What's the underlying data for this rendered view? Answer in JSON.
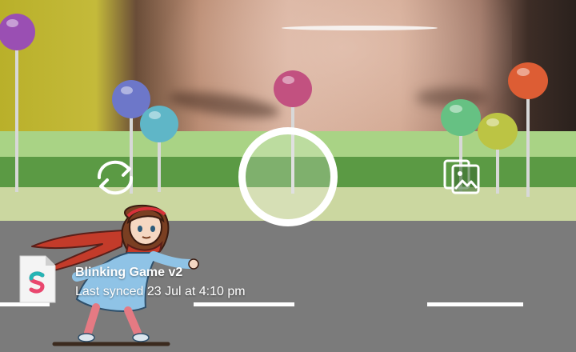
{
  "project": {
    "title": "Blinking Game v2",
    "last_synced": "Last synced 23 Jul at 4:10 pm"
  },
  "icons": {
    "switch_camera": "switch-camera-icon",
    "gallery": "gallery-icon",
    "project_file": "spark-ar-file-icon",
    "capture": "capture-button"
  },
  "colors": {
    "grass_light": "#a9d385",
    "grass_dark": "#5b9a44",
    "road": "#7b7b7b",
    "lollipop_purple": "#9a4fb3",
    "lollipop_blue": "#6d77c9",
    "lollipop_teal": "#5fb6c7",
    "lollipop_pink": "#c25180",
    "lollipop_green": "#66c183",
    "lollipop_olive": "#bcc444",
    "lollipop_orange": "#dd5d34"
  }
}
